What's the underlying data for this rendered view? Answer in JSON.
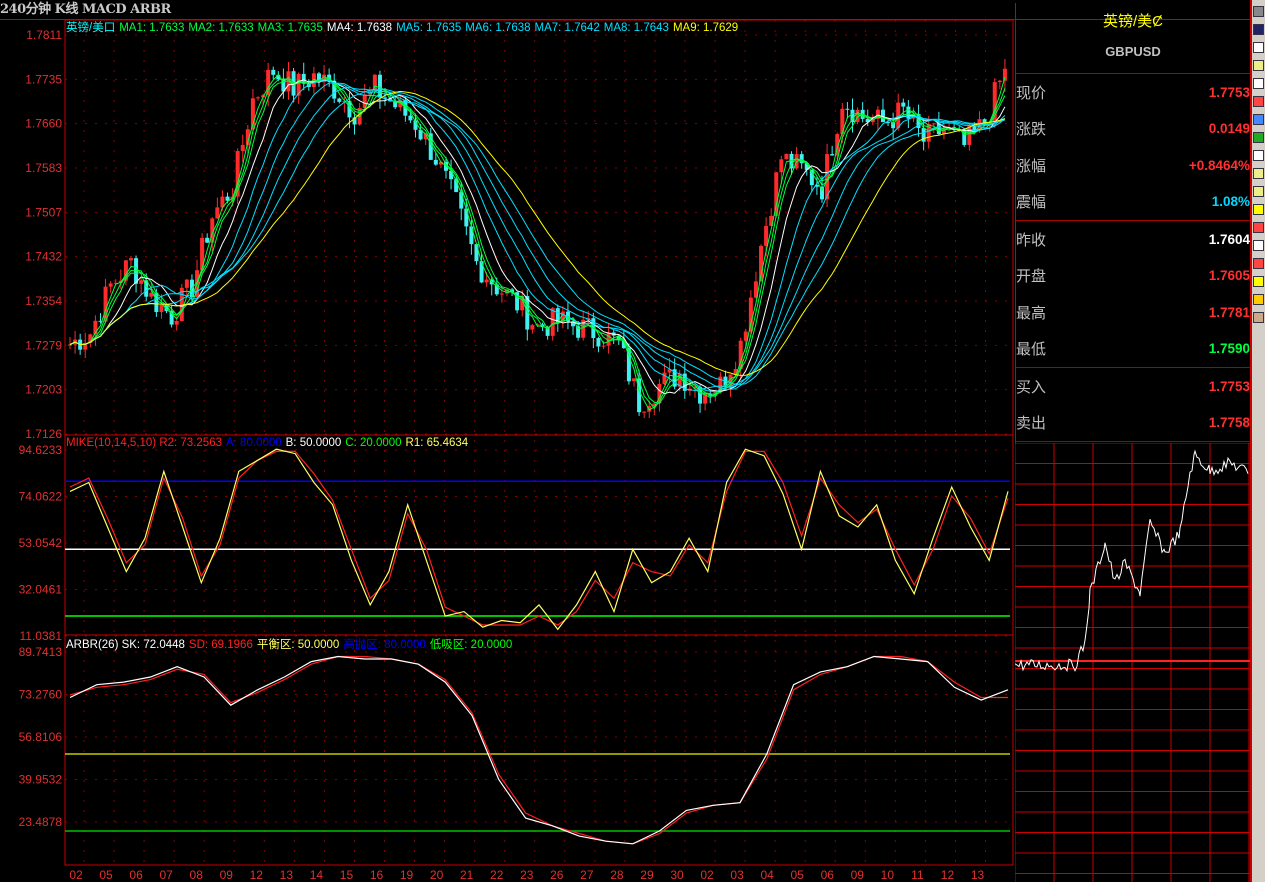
{
  "window": {
    "title": "240分钟 K线 MACD ARBR"
  },
  "main_legend": [
    {
      "text": "英镑/美口",
      "color": "#00ffff"
    },
    {
      "text": "MA1: 1.7633",
      "color": "#00ff40"
    },
    {
      "text": "MA2: 1.7633",
      "color": "#00ff40"
    },
    {
      "text": "MA3: 1.7635",
      "color": "#00ff40"
    },
    {
      "text": "MA4: 1.7638",
      "color": "#ffffff"
    },
    {
      "text": "MA5: 1.7635",
      "color": "#00e0ff"
    },
    {
      "text": "MA6: 1.7638",
      "color": "#00e0ff"
    },
    {
      "text": "MA7: 1.7642",
      "color": "#00e0ff"
    },
    {
      "text": "MA8: 1.7643",
      "color": "#00e0ff"
    },
    {
      "text": "MA9: 1.7629",
      "color": "#ffff00"
    }
  ],
  "mike_legend": [
    {
      "text": "MIKE(10,14,5,10) R2: 73.2563",
      "color": "#ff2020"
    },
    {
      "text": "A: 80.0000",
      "color": "#0000ff"
    },
    {
      "text": "B: 50.0000",
      "color": "#ffffff"
    },
    {
      "text": "C: 20.0000",
      "color": "#00ff00"
    },
    {
      "text": "R1: 65.4634",
      "color": "#ffff60"
    }
  ],
  "arbr_legend": [
    {
      "text": "ARBR(26) SK: 72.0448",
      "color": "#ffffff"
    },
    {
      "text": "SD: 69.1966",
      "color": "#ff2020"
    },
    {
      "text": "平衡区: 50.0000",
      "color": "#ffff60"
    },
    {
      "text": "高抛区: 80.0000",
      "color": "#0000ff"
    },
    {
      "text": "低吸区: 20.0000",
      "color": "#00ff00"
    }
  ],
  "quote": {
    "name": "英镑/美Ȼ",
    "code": "GBPUSD",
    "rows1": [
      {
        "k": "现价",
        "v": "1.7753",
        "c": "#ff3030"
      },
      {
        "k": "涨跌",
        "v": "0.0149",
        "c": "#ff3030"
      },
      {
        "k": "涨幅",
        "v": "+0.8464%",
        "c": "#ff3030"
      },
      {
        "k": "震幅",
        "v": "1.08%",
        "c": "#00d8ff"
      }
    ],
    "rows2": [
      {
        "k": "昨收",
        "v": "1.7604",
        "c": "#ffffff"
      },
      {
        "k": "开盘",
        "v": "1.7605",
        "c": "#ff3030"
      },
      {
        "k": "最高",
        "v": "1.7781",
        "c": "#ff3030"
      },
      {
        "k": "最低",
        "v": "1.7590",
        "c": "#00ff40"
      }
    ],
    "rows3": [
      {
        "k": "买入",
        "v": "1.7753",
        "c": "#ff3030"
      },
      {
        "k": "卖出",
        "v": "1.7758",
        "c": "#ff3030"
      }
    ]
  },
  "chart_data": [
    {
      "type": "candlestick",
      "title": "240分钟 K线",
      "yticks": [
        "1.7811",
        "1.7735",
        "1.7660",
        "1.7583",
        "1.7507",
        "1.7432",
        "1.7354",
        "1.7279",
        "1.7203",
        "1.7126"
      ],
      "ylim": [
        1.7126,
        1.7811
      ],
      "x_labels": [
        "02",
        "05",
        "06",
        "07",
        "08",
        "09",
        "12",
        "13",
        "14",
        "15",
        "16",
        "19",
        "20",
        "21",
        "22",
        "23",
        "26",
        "27",
        "28",
        "29",
        "30",
        "02",
        "03",
        "04",
        "05",
        "06",
        "09",
        "10",
        "11",
        "12",
        "13"
      ],
      "close_path": [
        1.728,
        1.73,
        1.738,
        1.742,
        1.736,
        1.733,
        1.738,
        1.75,
        1.755,
        1.77,
        1.775,
        1.772,
        1.774,
        1.772,
        1.768,
        1.772,
        1.769,
        1.766,
        1.76,
        1.752,
        1.742,
        1.738,
        1.735,
        1.731,
        1.732,
        1.731,
        1.73,
        1.728,
        1.718,
        1.721,
        1.723,
        1.72,
        1.721,
        1.728,
        1.745,
        1.76,
        1.758,
        1.755,
        1.77,
        1.767,
        1.766,
        1.768,
        1.763,
        1.765,
        1.762,
        1.766,
        1.7753
      ],
      "ma_periods": [
        3,
        4,
        5,
        8,
        12,
        16,
        20,
        24,
        30
      ],
      "ma_colors": [
        "#00ff40",
        "#00ff40",
        "#00ff40",
        "#ffffff",
        "#00e0ff",
        "#00e0ff",
        "#00e0ff",
        "#00e0ff",
        "#ffff00"
      ]
    },
    {
      "type": "line",
      "title": "MIKE",
      "yticks": [
        "94.6233",
        "74.0622",
        "53.0542",
        "32.0461",
        "11.0381"
      ],
      "ylim": [
        11.0381,
        94.6233
      ],
      "levels": [
        {
          "v": 80.6,
          "c": "#0000ff"
        },
        {
          "v": 50,
          "c": "#ffffff"
        },
        {
          "v": 20,
          "c": "#00ff00"
        }
      ],
      "series": [
        {
          "name": "R1",
          "color": "#ffff60",
          "values": [
            76,
            80,
            60,
            40,
            55,
            85,
            60,
            35,
            55,
            85,
            90,
            95,
            93,
            80,
            70,
            45,
            25,
            40,
            70,
            45,
            20,
            22,
            15,
            18,
            17,
            25,
            14,
            25,
            40,
            22,
            50,
            35,
            40,
            55,
            40,
            80,
            95,
            92,
            75,
            50,
            85,
            65,
            60,
            70,
            45,
            30,
            55,
            78,
            60,
            45,
            76
          ]
        },
        {
          "name": "R2",
          "color": "#ff2020",
          "values": [
            78,
            82,
            64,
            44,
            52,
            82,
            64,
            38,
            52,
            82,
            90,
            94,
            94,
            84,
            72,
            50,
            28,
            36,
            66,
            50,
            24,
            20,
            16,
            16,
            16,
            20,
            16,
            22,
            36,
            28,
            44,
            40,
            38,
            52,
            44,
            76,
            94,
            94,
            80,
            56,
            82,
            70,
            62,
            68,
            50,
            34,
            50,
            74,
            64,
            48,
            73
          ]
        }
      ]
    },
    {
      "type": "line",
      "title": "ARBR",
      "yticks": [
        "89.7413",
        "73.2760",
        "56.8106",
        "39.9532",
        "23.4878"
      ],
      "ylim": [
        23.4878,
        89.7413
      ],
      "levels": [
        {
          "v": 50,
          "c": "#c8c800"
        },
        {
          "v": 20,
          "c": "#00c000"
        }
      ],
      "series": [
        {
          "name": "SK",
          "color": "#ffffff",
          "values": [
            72,
            77,
            78,
            80,
            84,
            80,
            69,
            75,
            80,
            86,
            88,
            87,
            87,
            85,
            78,
            65,
            40,
            25,
            22,
            18,
            16,
            15,
            20,
            28,
            30,
            31,
            50,
            77,
            82,
            84,
            88,
            87,
            86,
            76,
            71,
            75
          ]
        },
        {
          "name": "SD",
          "color": "#ff2020",
          "values": [
            73,
            76,
            77,
            79,
            83,
            81,
            70,
            74,
            79,
            85,
            88,
            88,
            87,
            85,
            79,
            66,
            42,
            27,
            22,
            19,
            16,
            15,
            19,
            27,
            30,
            31,
            48,
            75,
            81,
            84,
            88,
            88,
            86,
            78,
            72,
            72
          ]
        }
      ]
    }
  ]
}
